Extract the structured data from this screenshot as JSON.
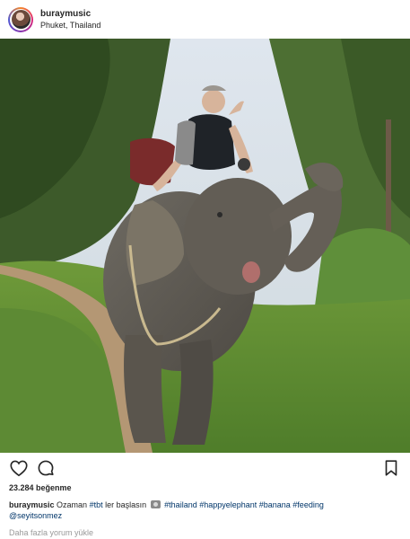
{
  "header": {
    "username": "buraymusic",
    "location": "Phuket, Thailand"
  },
  "photo": {
    "alt": "Man riding an elephant in a jungle"
  },
  "actions": {
    "like_icon": "heart-icon",
    "comment_icon": "comment-icon",
    "save_icon": "bookmark-icon"
  },
  "likes": {
    "text": "23.284 beğenme"
  },
  "caption": {
    "username": "buraymusic",
    "text_before_emoji": "Ozaman",
    "hashtag_tbt": "#tbt",
    "text_after_tbt": "ler başlasın",
    "hashtags": "#thailand #happyelephant #banana #feeding",
    "mention": "@seyitsonmez"
  },
  "comments": {
    "load_more": "Daha fazla yorum yükle"
  },
  "colors": {
    "text": "#262626",
    "link": "#003569",
    "muted": "#999999"
  }
}
